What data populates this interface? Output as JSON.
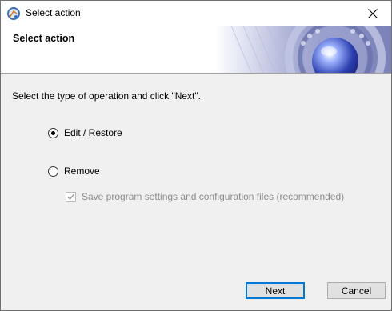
{
  "window": {
    "title": "Select action",
    "icon": "app-logo-icon",
    "close_icon": "close-icon"
  },
  "banner": {
    "title": "Select action"
  },
  "main": {
    "instruction": "Select the type of operation and click \"Next\".",
    "options": [
      {
        "label": "Edit / Restore",
        "checked": true
      },
      {
        "label": "Remove",
        "checked": false
      }
    ],
    "save_settings": {
      "label": "Save program settings and configuration files (recommended)",
      "checked": true,
      "disabled": true
    }
  },
  "buttons": {
    "next": "Next",
    "cancel": "Cancel"
  },
  "colors": {
    "accent": "#0078d7",
    "disabled_text": "#8c8c8c",
    "background": "#f0f0f0"
  }
}
